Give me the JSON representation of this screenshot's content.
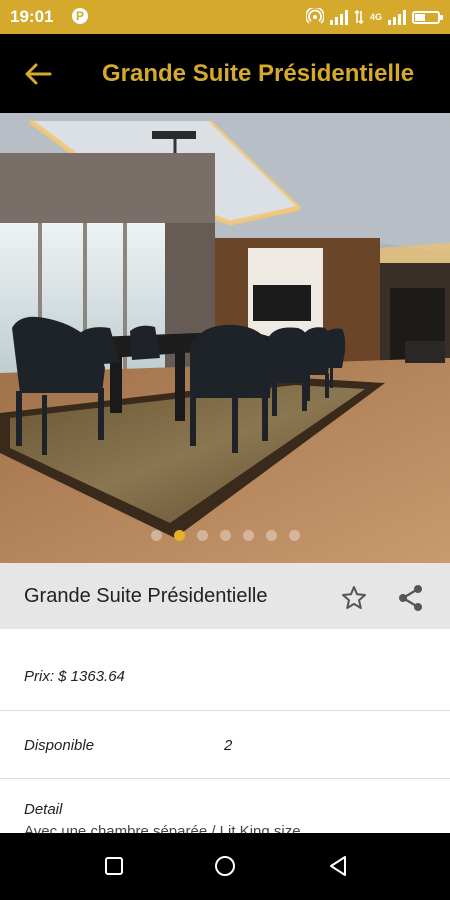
{
  "status_bar": {
    "time": "19:01",
    "p_badge": "P",
    "network_label": "4G",
    "colors": {
      "background": "#d4a92c"
    }
  },
  "app_bar": {
    "title": "Grande Suite Présidentielle",
    "back_icon": "arrow-left-icon",
    "colors": {
      "background": "#000000",
      "title": "#d4a92c"
    }
  },
  "gallery": {
    "total_images": 7,
    "active_index": 1
  },
  "room": {
    "name": "Grande Suite Présidentielle",
    "favorite_icon": "star-outline-icon",
    "share_icon": "share-icon"
  },
  "details": {
    "price": "Prix: $ 1363.64",
    "available_label": "Disponible",
    "available_value": "2",
    "detail_label": "Detail",
    "detail_text": "Avec une chambre séparée / Lit King size"
  },
  "nav": {
    "recents_icon": "square-icon",
    "home_icon": "circle-icon",
    "back_icon": "triangle-back-icon"
  }
}
